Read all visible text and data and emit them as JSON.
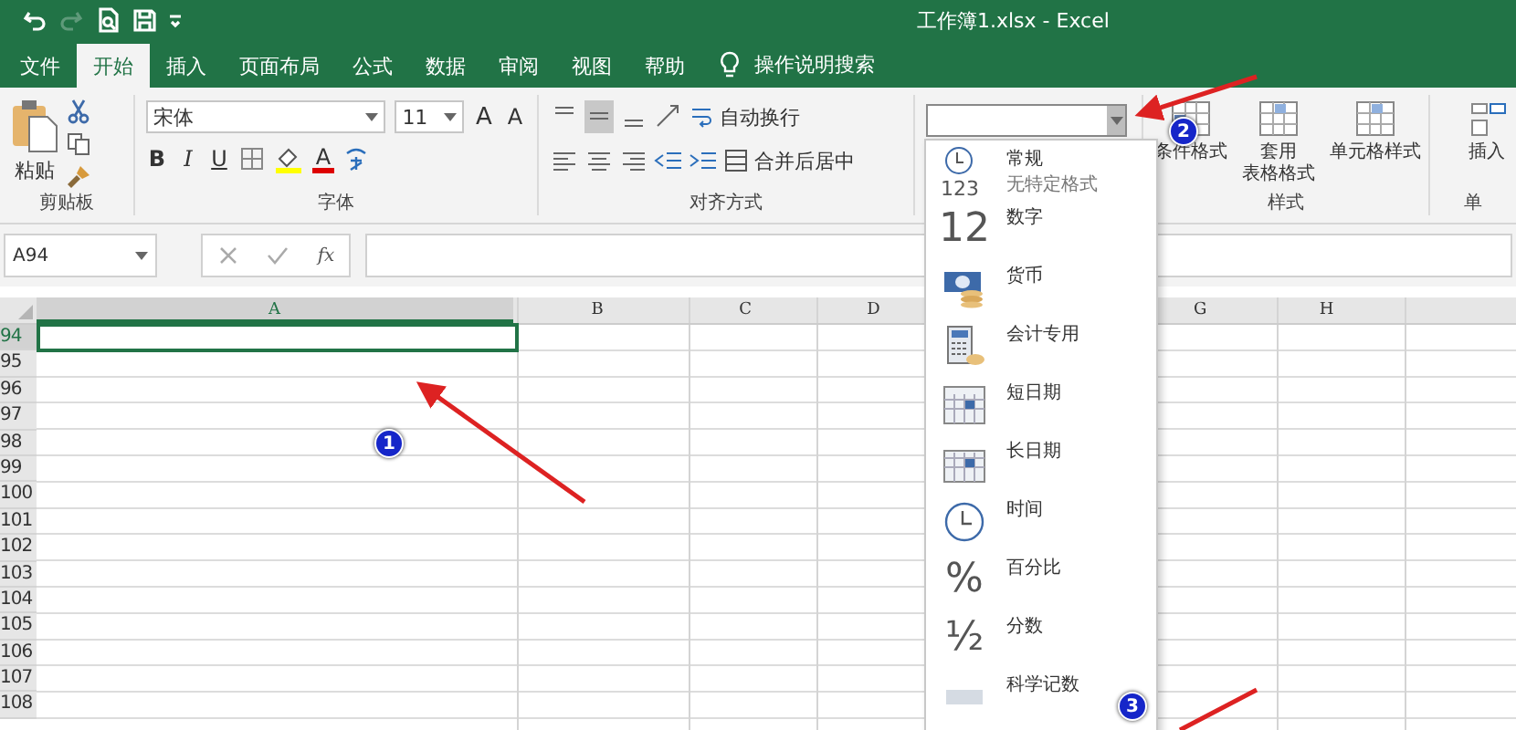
{
  "window": {
    "title": "工作簿1.xlsx  -  Excel"
  },
  "quick_access": [
    {
      "kind": "undo",
      "disabled": false
    },
    {
      "kind": "redo",
      "disabled": true
    },
    {
      "kind": "preview",
      "disabled": false
    },
    {
      "kind": "save",
      "disabled": false
    },
    {
      "kind": "customize",
      "disabled": false
    }
  ],
  "tabs": [
    {
      "label": "文件",
      "selected": false
    },
    {
      "label": "开始",
      "selected": true
    },
    {
      "label": "插入",
      "selected": false
    },
    {
      "label": "页面布局",
      "selected": false
    },
    {
      "label": "公式",
      "selected": false
    },
    {
      "label": "数据",
      "selected": false
    },
    {
      "label": "审阅",
      "selected": false
    },
    {
      "label": "视图",
      "selected": false
    },
    {
      "label": "帮助",
      "selected": false
    }
  ],
  "tell_me": {
    "label": "操作说明搜索"
  },
  "ribbon": {
    "clipboard": {
      "paste": "粘贴",
      "label": "剪贴板"
    },
    "font": {
      "name": "宋体",
      "size": "11",
      "grow": "A",
      "shrink": "A",
      "bold": "B",
      "italic": "I",
      "underline": "U",
      "font_color": "A",
      "label": "字体"
    },
    "alignment": {
      "wrap": "自动换行",
      "merge": "合并后居中",
      "label": "对齐方式"
    },
    "styles": {
      "buttons": [
        {
          "lines": [
            "条件格式"
          ]
        },
        {
          "lines": [
            "套用",
            "表格格式"
          ]
        },
        {
          "lines": [
            "单元格样式"
          ]
        }
      ],
      "label": "样式"
    },
    "cells": {
      "buttons": [
        "插入"
      ],
      "label": "单"
    }
  },
  "formula_bar": {
    "name_box": "A94",
    "fx": "fx"
  },
  "sheet": {
    "columns": [
      {
        "label": "A",
        "selected": true
      },
      {
        "label": "B",
        "selected": false
      },
      {
        "label": "C",
        "selected": false
      },
      {
        "label": "D",
        "selected": false
      },
      {
        "label": "G",
        "selected": false
      },
      {
        "label": "H",
        "selected": false
      }
    ],
    "rows": [
      {
        "label": "94",
        "selected": true
      },
      {
        "label": "95",
        "selected": false
      },
      {
        "label": "96",
        "selected": false
      },
      {
        "label": "97",
        "selected": false
      },
      {
        "label": "98",
        "selected": false
      },
      {
        "label": "99",
        "selected": false
      },
      {
        "label": "100",
        "selected": false
      },
      {
        "label": "101",
        "selected": false
      },
      {
        "label": "102",
        "selected": false
      },
      {
        "label": "103",
        "selected": false
      },
      {
        "label": "104",
        "selected": false
      },
      {
        "label": "105",
        "selected": false
      },
      {
        "label": "106",
        "selected": false
      },
      {
        "label": "107",
        "selected": false
      },
      {
        "label": "108",
        "selected": false
      }
    ]
  },
  "number_format_menu": {
    "items": [
      {
        "kind": "general",
        "glyph": "123",
        "label": "常规",
        "detail": "无特定格式"
      },
      {
        "kind": "number",
        "glyph": "12",
        "label": "数字"
      },
      {
        "kind": "currency",
        "label": "货币"
      },
      {
        "kind": "accounting",
        "label": "会计专用"
      },
      {
        "kind": "short_date",
        "label": "短日期"
      },
      {
        "kind": "long_date",
        "label": "长日期"
      },
      {
        "kind": "time",
        "label": "时间"
      },
      {
        "kind": "percent",
        "glyph": "%",
        "label": "百分比"
      },
      {
        "kind": "fraction",
        "glyph": "½",
        "label": "分数"
      },
      {
        "kind": "scientific",
        "label": "科学记数"
      }
    ]
  },
  "annotations": [
    {
      "number": "1"
    },
    {
      "number": "2"
    },
    {
      "number": "3"
    }
  ]
}
